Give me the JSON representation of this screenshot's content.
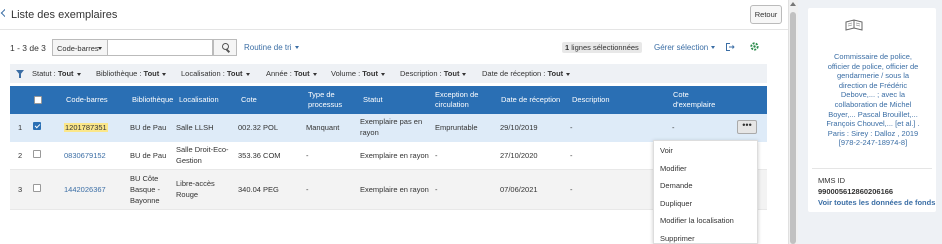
{
  "header": {
    "title": "Liste des exemplaires",
    "back_label": "Retour"
  },
  "toolbar": {
    "range": "1 - 3 de 3",
    "search_type": "Code-barres",
    "search_placeholder": "",
    "routine": "Routine de tri",
    "selected_count": "1",
    "selected_suffix": "lignes sélectionnées",
    "gerer": "Gérer sélection"
  },
  "filters": [
    {
      "label": "Statut :",
      "value": "Tout"
    },
    {
      "label": "Bibliothèque :",
      "value": "Tout"
    },
    {
      "label": "Localisation :",
      "value": "Tout"
    },
    {
      "label": "Année :",
      "value": "Tout"
    },
    {
      "label": "Volume :",
      "value": "Tout"
    },
    {
      "label": "Description :",
      "value": "Tout"
    },
    {
      "label": "Date de réception :",
      "value": "Tout"
    }
  ],
  "table": {
    "headers": {
      "barcode": "Code-barres",
      "library": "Bibliothèque",
      "location": "Localisation",
      "cote": "Cote",
      "process_1": "Type de",
      "process_2": "processus",
      "status": "Statut",
      "exception_1": "Exception de",
      "exception_2": "circulation",
      "receipt": "Date de réception",
      "description": "Description",
      "copy_cote_1": "Cote",
      "copy_cote_2": "d'exemplaire"
    },
    "rows": [
      {
        "num": "1",
        "barcode": "1201787351",
        "library": "BU de Pau",
        "location_1": "Salle LLSH",
        "location_2": "",
        "location_3": "",
        "cote": "002.32 POL",
        "process": "Manquant",
        "status_1": "Exemplaire pas en",
        "status_2": "rayon",
        "exception": "Empruntable",
        "receipt": "29/10/2019",
        "description": "-",
        "copy_cote": "-"
      },
      {
        "num": "2",
        "barcode": "0830679152",
        "library": "BU de Pau",
        "location_1": "Salle Droit-Eco-",
        "location_2": "Gestion",
        "location_3": "",
        "cote": "353.36 COM",
        "process": "-",
        "status_1": "Exemplaire en rayon",
        "status_2": "",
        "exception": "-",
        "receipt": "27/10/2020",
        "description": "-",
        "copy_cote": "-"
      },
      {
        "num": "3",
        "barcode": "1442026367",
        "library_1": "BU Côte",
        "library_2": "Basque -",
        "library_3": "Bayonne",
        "location_1": "Libre-accès",
        "location_2": "Rouge",
        "cote": "340.04 PEG",
        "process": "-",
        "status_1": "Exemplaire en rayon",
        "status_2": "",
        "exception": "-",
        "receipt": "07/06/2021",
        "description": "-",
        "copy_cote": "-"
      }
    ]
  },
  "row_menu": {
    "button": "•••",
    "items": [
      "Voir",
      "Modifier",
      "Demande",
      "Dupliquer",
      "Modifier la localisation",
      "Supprimer"
    ]
  },
  "side": {
    "record_lines": [
      "Commissaire de police,",
      "officier de police, officier de",
      "gendarmerie / sous la",
      "direction de Frédéric",
      "Debove,... ; avec la",
      "collaboration de Michel",
      "Boyer,... Pascal Brouillet,...",
      "François Chouvel,... [et al.] .",
      "Paris : Sirey : Dalloz , 2019",
      "[978-2-247-18974-8]"
    ],
    "mms_label": "MMS ID",
    "mms_value": "990005612860206166",
    "voir_all": "Voir toutes les données de fonds"
  },
  "colors": {
    "accent": "#2a6fb4",
    "link": "#3b6ea5",
    "selected_row": "#deebf8",
    "highlight": "#fbe78a"
  }
}
